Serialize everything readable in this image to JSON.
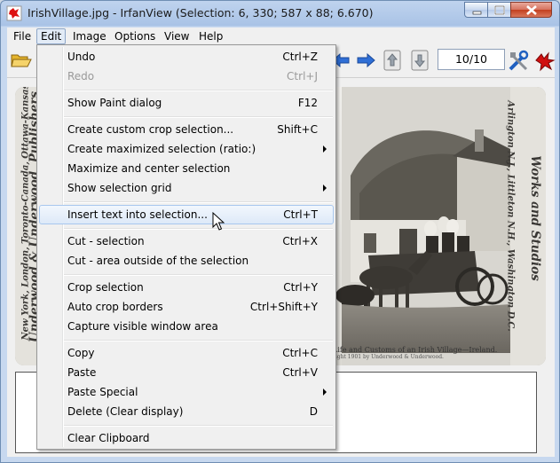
{
  "window": {
    "title": "IrishVillage.jpg - IrfanView (Selection: 6, 330; 587 x 88; 6.670)"
  },
  "menubar": {
    "items": [
      "File",
      "Edit",
      "Image",
      "Options",
      "View",
      "Help"
    ],
    "open_item": "Edit"
  },
  "toolbar": {
    "page_indicator": "10/10",
    "icons": [
      "open-folder-icon",
      "back-arrow-icon",
      "forward-arrow-icon",
      "page-up-icon",
      "page-down-icon",
      "tools-icon",
      "irfanview-logo-icon"
    ]
  },
  "image": {
    "left_side_line1": "Underwood & Underwood, Publishers",
    "left_side_line2": "New York, London, Toronto-Canada, Ottawa-Kansas",
    "right_side_line1": "Works and Studios",
    "right_side_line2": "Arlington N.J., Littleton N.H., Washington D.C.",
    "caption": "Life and Customs of an Irish Village—Ireland.",
    "copyright": "right 1901 by Underwood & Underwood."
  },
  "edit_menu": {
    "items": [
      {
        "label": "Undo",
        "shortcut": "Ctrl+Z"
      },
      {
        "label": "Redo",
        "shortcut": "Ctrl+J",
        "disabled": true
      },
      {
        "label": "Show Paint dialog",
        "shortcut": "F12"
      },
      {
        "label": "Create custom crop selection...",
        "shortcut": "Shift+C"
      },
      {
        "label": "Create maximized selection (ratio:)",
        "submenu": true
      },
      {
        "label": "Maximize and center selection"
      },
      {
        "label": "Show selection grid",
        "submenu": true
      },
      {
        "label": "Insert text into selection...",
        "shortcut": "Ctrl+T",
        "highlighted": true
      },
      {
        "label": "Cut - selection",
        "shortcut": "Ctrl+X"
      },
      {
        "label": "Cut - area outside of the selection"
      },
      {
        "label": "Crop selection",
        "shortcut": "Ctrl+Y"
      },
      {
        "label": "Auto crop borders",
        "shortcut": "Ctrl+Shift+Y"
      },
      {
        "label": "Capture visible window area"
      },
      {
        "label": "Copy",
        "shortcut": "Ctrl+C"
      },
      {
        "label": "Paste",
        "shortcut": "Ctrl+V"
      },
      {
        "label": "Paste Special",
        "submenu": true
      },
      {
        "label": "Delete (Clear display)",
        "shortcut": "D"
      },
      {
        "label": "Clear Clipboard"
      }
    ]
  }
}
